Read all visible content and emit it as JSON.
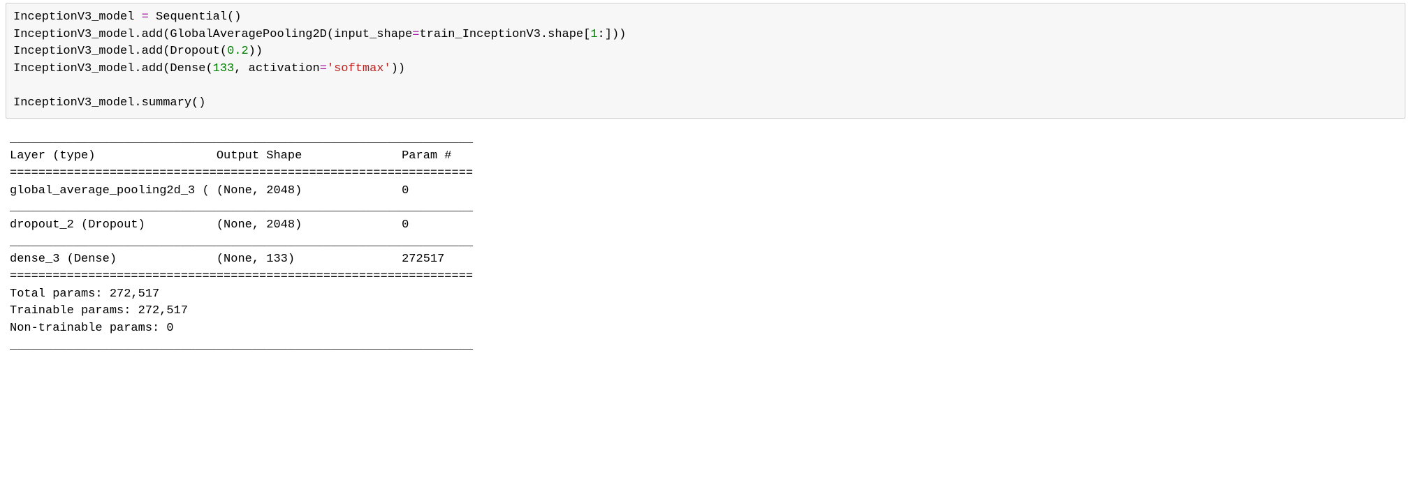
{
  "code": {
    "l1_a": "InceptionV3_model ",
    "l1_op": "=",
    "l1_b": " Sequential()",
    "l2_a": "InceptionV3_model.add(GlobalAveragePooling2D(input_shape",
    "l2_op": "=",
    "l2_b": "train_InceptionV3.shape[",
    "l2_num": "1",
    "l2_c": ":]))",
    "l3_a": "InceptionV3_model.add(Dropout(",
    "l3_num": "0.2",
    "l3_b": "))",
    "l4_a": "InceptionV3_model.add(Dense(",
    "l4_num": "133",
    "l4_b": ", activation",
    "l4_op": "=",
    "l4_str": "'softmax'",
    "l4_c": "))",
    "l5": "",
    "l6": "InceptionV3_model.summary()"
  },
  "out": {
    "rule_top": "_________________________________________________________________",
    "header": "Layer (type)                 Output Shape              Param #   ",
    "rule_dbl": "=================================================================",
    "row1": "global_average_pooling2d_3 ( (None, 2048)              0         ",
    "rule_mid": "_________________________________________________________________",
    "row2": "dropout_2 (Dropout)          (None, 2048)              0         ",
    "row3": "dense_3 (Dense)              (None, 133)               272517    ",
    "total": "Total params: 272,517",
    "train": "Trainable params: 272,517",
    "nontrain": "Non-trainable params: 0"
  }
}
